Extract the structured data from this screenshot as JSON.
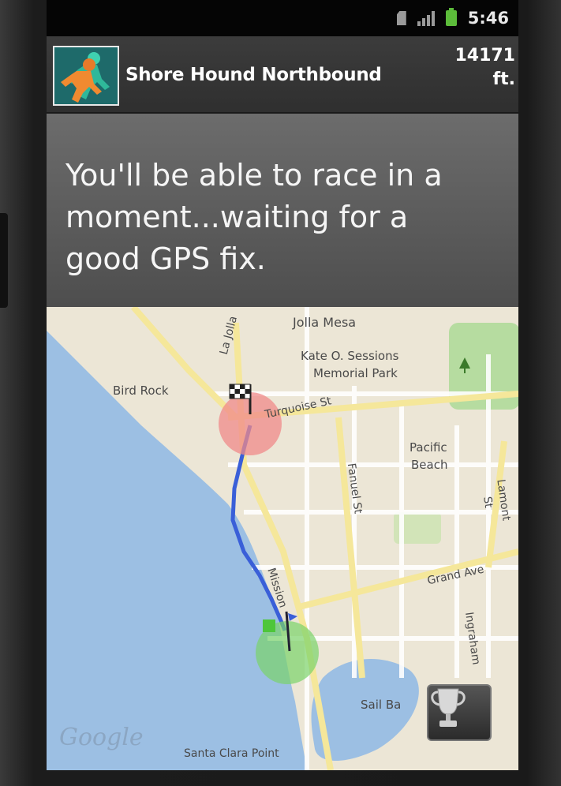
{
  "status_bar": {
    "time": "5:46",
    "icons": [
      "sim-card-icon",
      "signal-strength-icon",
      "battery-charging-icon"
    ]
  },
  "app_header": {
    "logo": "runner-logo-icon",
    "title": "Shore Hound Northbound",
    "elevation_value": "14171",
    "elevation_unit": "ft."
  },
  "message": {
    "text": "You'll be able to race in a moment...waiting for a good GPS fix."
  },
  "map": {
    "labels": {
      "jolla_mesa": "Jolla Mesa",
      "kate_sessions_1": "Kate O. Sessions",
      "kate_sessions_2": "Memorial Park",
      "bird_rock": "Bird Rock",
      "turquoise": "Turquoise St",
      "la_jolla": "La Jolla",
      "pacific_beach_1": "Pacific",
      "pacific_beach_2": "Beach",
      "fanuel": "Fanuel St",
      "lamont": "Lamont St",
      "mission": "Mission",
      "grand": "Grand Ave",
      "ingraham": "Ingraham",
      "sail_bay": "Sail Ba",
      "santa_clara": "Santa Clara Point"
    },
    "watermark": "Google",
    "markers": [
      "finish-flag-icon",
      "start-flag-icon"
    ],
    "trophy_button": "trophy-icon",
    "colors": {
      "water": "#9cbfe3",
      "route": "#3a5fd8",
      "finish_circle": "#f08a8a",
      "start_circle": "#7bd36a",
      "park": "#b6dca0"
    }
  }
}
